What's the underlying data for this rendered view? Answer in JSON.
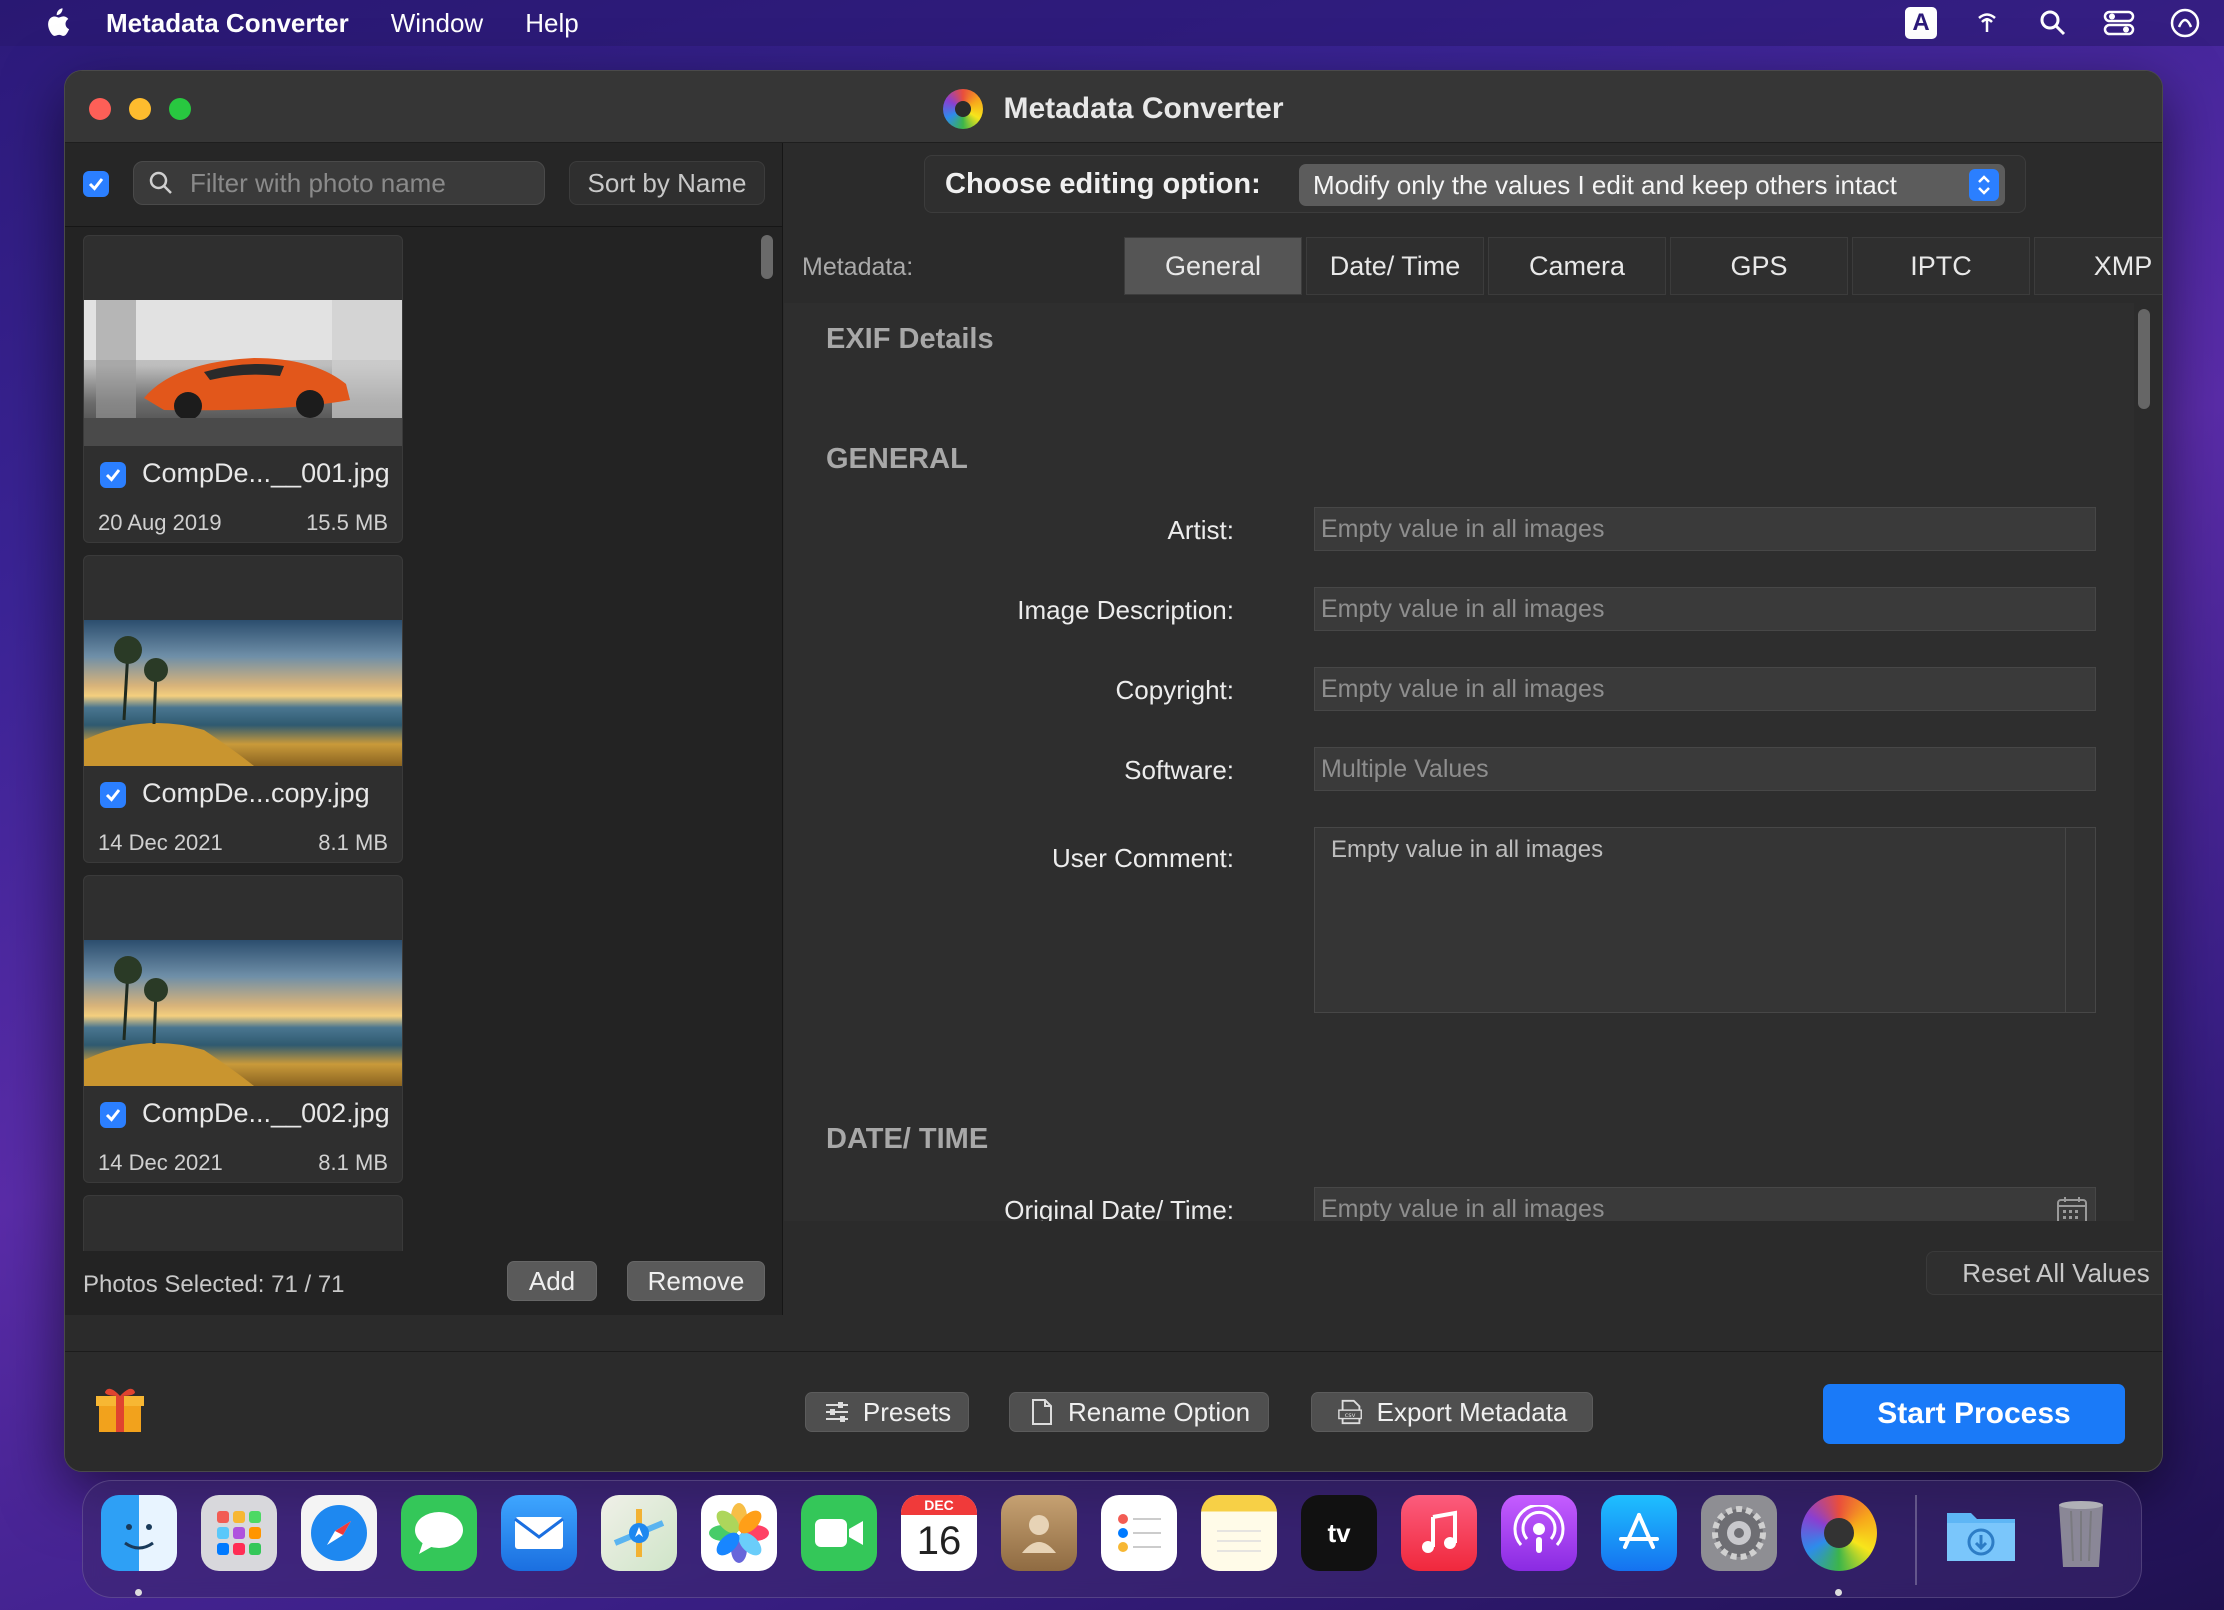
{
  "menubar": {
    "app_name": "Metadata Converter",
    "items": [
      "Window",
      "Help"
    ],
    "input_badge": "A"
  },
  "window": {
    "title": "Metadata Converter"
  },
  "left_panel": {
    "filter_placeholder": "Filter with photo name",
    "sort_label": "Sort by Name",
    "photos": [
      {
        "name": "CompDe...__001.jpg",
        "date": "20 Aug 2019",
        "size": "15.5 MB",
        "checked": true,
        "thumb": "orange-sports-car"
      },
      {
        "name": "CompDe...copy.jpg",
        "date": "14 Dec 2021",
        "size": "8.1 MB",
        "checked": true,
        "thumb": "seaside-sunset"
      },
      {
        "name": "CompDe...__002.jpg",
        "date": "14 Dec 2021",
        "size": "8.1 MB",
        "checked": true,
        "thumb": "seaside-sunset"
      }
    ],
    "photos_selected": "Photos Selected: 71 / 71",
    "add_label": "Add",
    "remove_label": "Remove"
  },
  "right_panel": {
    "editing_option_label": "Choose editing option:",
    "editing_option_value": "Modify only the values I edit and keep others intact",
    "metadata_label": "Metadata:",
    "tabs": [
      "General",
      "Date/ Time",
      "Camera",
      "GPS",
      "IPTC",
      "XMP"
    ],
    "active_tab": "General",
    "section_exif": "EXIF Details",
    "section_general": "GENERAL",
    "fields": {
      "artist": {
        "label": "Artist:",
        "placeholder": "Empty value in all images"
      },
      "image_description": {
        "label": "Image Description:",
        "placeholder": "Empty value in all images"
      },
      "copyright": {
        "label": "Copyright:",
        "placeholder": "Empty value in all images"
      },
      "software": {
        "label": "Software:",
        "placeholder": "Multiple Values"
      },
      "user_comment": {
        "label": "User Comment:",
        "placeholder": "Empty value in all images"
      }
    },
    "section_datetime": "DATE/ TIME",
    "original_datetime": {
      "label": "Original Date/ Time:",
      "placeholder": "Empty value in all images"
    },
    "reset_label": "Reset All Values"
  },
  "bottom_bar": {
    "presets_label": "Presets",
    "rename_label": "Rename Option",
    "export_label": "Export Metadata",
    "start_label": "Start Process"
  },
  "dock": {
    "calendar_month": "DEC",
    "calendar_day": "16",
    "tv_label": "tv",
    "apps": [
      "finder",
      "launchpad",
      "safari",
      "messages",
      "mail",
      "maps",
      "photos",
      "facetime",
      "calendar",
      "contacts",
      "reminders",
      "notes",
      "apple-tv",
      "music",
      "podcasts",
      "app-store",
      "system-preferences",
      "metadata-converter",
      "downloads",
      "trash"
    ]
  },
  "colors": {
    "accent": "#1a7af8",
    "checkbox": "#2b7fff",
    "window_bg": "#2b2b2b"
  }
}
